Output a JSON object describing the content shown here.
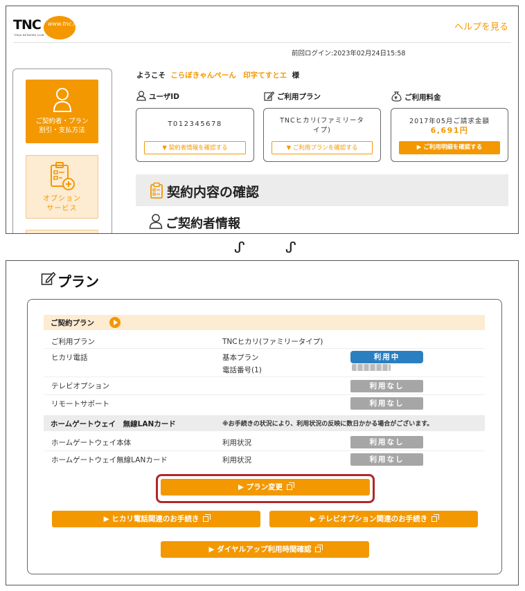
{
  "header": {
    "logo_text": "TNC",
    "logo_sub": "TOKAI NETWORK CLUB",
    "logo_badge": "www.tnc.ne.jp",
    "help_link": "ヘルプを見る",
    "last_login": "前回ログイン:2023年02月24日15:58"
  },
  "side_menu": {
    "active_label_1": "ご契約者・プラン",
    "active_label_2": "割引・支払方法",
    "option_label_1": "オプション",
    "option_label_2": "サービス"
  },
  "welcome": {
    "prefix": "ようこそ",
    "name": "こらぼきゃんぺーん　印字てすとエ",
    "suffix": "様"
  },
  "user_id": {
    "heading": "ユーザID",
    "value": "T012345678",
    "button": "▼ 契約者情報を確認する"
  },
  "plan_card": {
    "heading": "ご利用プラン",
    "value_1": "TNCヒカリ(ファミリータ",
    "value_2": "イプ)",
    "button": "▼ ご利用プランを確認する"
  },
  "billing": {
    "heading": "ご利用料金",
    "label": "2017年05月ご請求金額",
    "amount": "6,691円",
    "button": "▶ ご利用明細を確認する"
  },
  "section": {
    "title": "契約内容の確認",
    "subtitle": "ご契約者情報"
  },
  "divider": {
    "left": "ᔑ",
    "right": "ᔑ"
  },
  "plan_section": {
    "heading": "プラン",
    "contract_band": "ご契約プラン",
    "rows": [
      {
        "label": "ご利用プラン",
        "value": "TNCヒカリ(ファミリータイプ)"
      },
      {
        "label": "ヒカリ電話",
        "value": "基本プラン",
        "value2": "電話番号(1)",
        "status": "利用中"
      },
      {
        "label": "テレビオプション",
        "status": "利用なし"
      },
      {
        "label": "リモートサポート",
        "status": "利用なし"
      }
    ],
    "hg_band": "ホームゲートウェイ　無線LANカード",
    "hg_note": "※お手続きの状況により、利用状況の反映に数日かかる場合がございます。",
    "hg_rows": [
      {
        "label": "ホームゲートウェイ本体",
        "value": "利用状況",
        "status": "利用なし"
      },
      {
        "label": "ホームゲートウェイ無線LANカード",
        "value": "利用状況",
        "status": "利用なし"
      }
    ],
    "buttons": {
      "plan_change": "▶ プラン変更",
      "hikari_phone": "▶ ヒカリ電話関連のお手続き",
      "tv_option": "▶ テレビオプション関連のお手続き",
      "dialup": "▶ ダイヤルアップ利用時間確認"
    }
  }
}
